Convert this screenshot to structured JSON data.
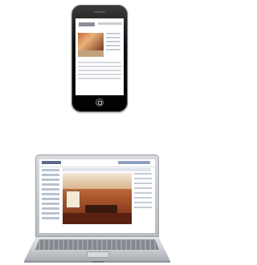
{
  "scene": {
    "devices": [
      {
        "id": "phone",
        "icon": "smartphone-icon"
      },
      {
        "id": "laptop",
        "icon": "laptop-icon"
      }
    ]
  },
  "colors": {
    "background": "#ffffff",
    "phone_body": "#000000",
    "laptop_body": "#c7cacf",
    "photo_warm": "#b05a2e"
  }
}
